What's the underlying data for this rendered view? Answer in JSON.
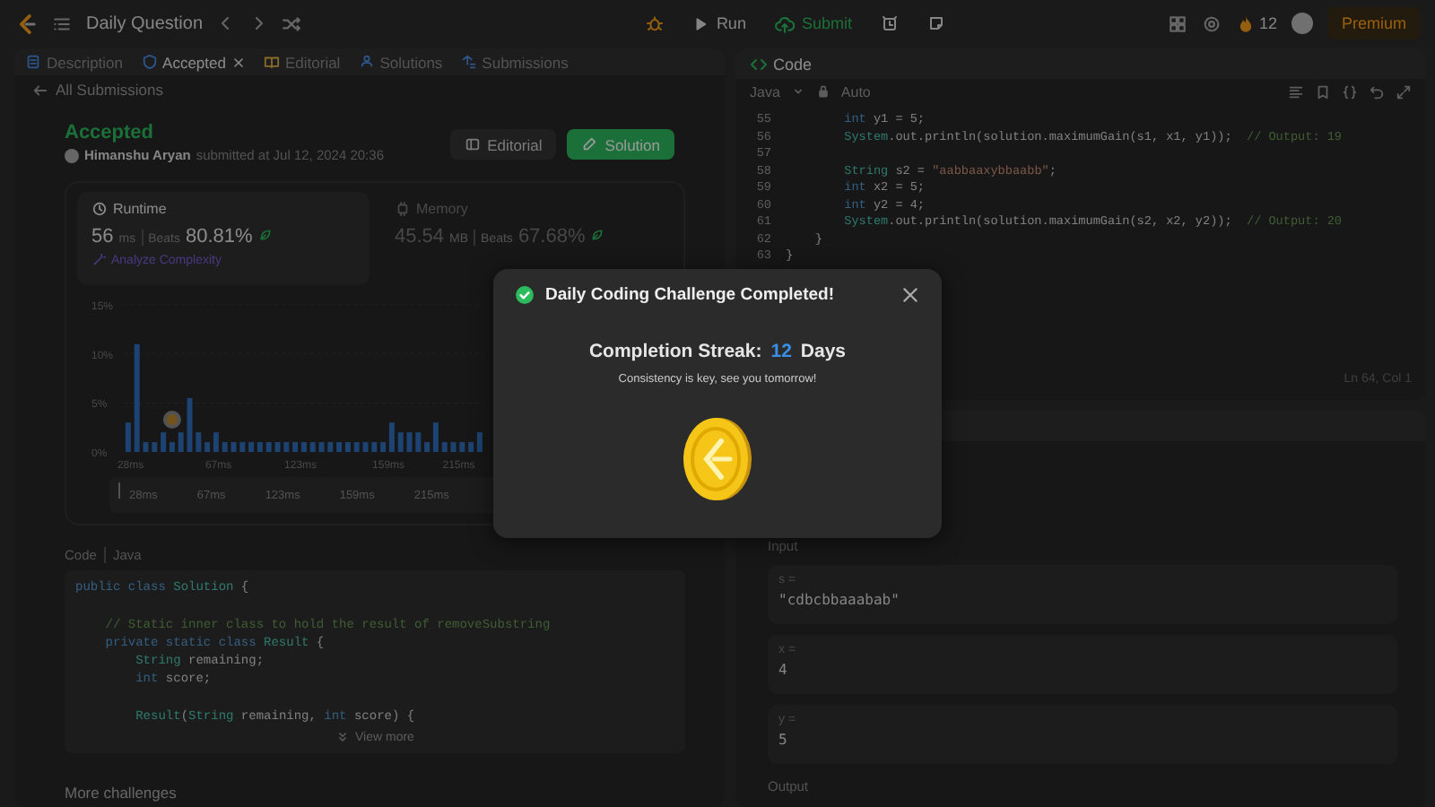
{
  "top_bar": {
    "title": "Daily Question",
    "run": "Run",
    "submit": "Submit",
    "streak": "12",
    "premium": "Premium"
  },
  "left_panel": {
    "tabs": [
      {
        "label": "Description",
        "selected": false,
        "closable": false
      },
      {
        "label": "Accepted",
        "selected": true,
        "closable": true
      },
      {
        "label": "Editorial",
        "selected": false,
        "closable": false
      },
      {
        "label": "Solutions",
        "selected": false,
        "closable": false
      },
      {
        "label": "Submissions",
        "selected": false,
        "closable": false
      }
    ],
    "back": "All Submissions",
    "submission": {
      "status": "Accepted",
      "author": "Himanshu Aryan",
      "submitted": "submitted at Jul 12, 2024 20:36",
      "buttons": [
        {
          "label": "Editorial",
          "kind": "secondary"
        },
        {
          "label": "Solution",
          "kind": "primary"
        }
      ]
    },
    "stats": [
      {
        "label": "Runtime",
        "value": "56",
        "unit": "ms",
        "beats_label": "Beats",
        "beats": "80.81%",
        "link": "Analyze Complexity",
        "selected": true
      },
      {
        "label": "Memory",
        "value": "45.54",
        "unit": "MB",
        "beats_label": "Beats",
        "beats": "67.68%",
        "selected": false
      }
    ],
    "chart_data": {
      "type": "bar",
      "ylim": [
        0,
        15
      ],
      "yticks": [
        {
          "value": 0,
          "label": "0%"
        },
        {
          "value": 5,
          "label": "5%"
        },
        {
          "value": 10,
          "label": "10%"
        },
        {
          "value": 15,
          "label": "15%"
        }
      ],
      "values": [
        3,
        11,
        1,
        1,
        2,
        1,
        2,
        5.5,
        2,
        1,
        2,
        1,
        1,
        1,
        1,
        1,
        1,
        1,
        1,
        1,
        1,
        1,
        1,
        1,
        1,
        1,
        1,
        1,
        1,
        1,
        3,
        2,
        2,
        2,
        1,
        3,
        1,
        1,
        1,
        1,
        2
      ]
    },
    "chart_axis_labels": [
      "28ms",
      "67ms",
      "123ms",
      "159ms",
      "215ms"
    ],
    "range": {
      "labels": [
        "28ms",
        "67ms",
        "123ms",
        "159ms",
        "215ms"
      ]
    },
    "code": {
      "label": "Code",
      "language": "Java",
      "view_more": "View more",
      "lines": [
        {
          "kind": "code",
          "tokens": [
            {
              "kind": "kw",
              "t": "public class"
            },
            {
              "kind": "type",
              "t": " Solution"
            },
            {
              "kind": "plain",
              "t": " {"
            }
          ]
        },
        {
          "kind": "blank"
        },
        {
          "kind": "code",
          "tokens": [
            {
              "kind": "com",
              "t": "    // Static inner class to hold the result of removeSubstring"
            }
          ]
        },
        {
          "kind": "code",
          "tokens": [
            {
              "kind": "kw",
              "t": "    private static class"
            },
            {
              "kind": "type",
              "t": " Result"
            },
            {
              "kind": "plain",
              "t": " {"
            }
          ]
        },
        {
          "kind": "code",
          "tokens": [
            {
              "kind": "type",
              "t": "        String"
            },
            {
              "kind": "plain",
              "t": " remaining;"
            }
          ]
        },
        {
          "kind": "code",
          "tokens": [
            {
              "kind": "kw",
              "t": "        int"
            },
            {
              "kind": "plain",
              "t": " score;"
            }
          ]
        },
        {
          "kind": "blank"
        },
        {
          "kind": "code",
          "tokens": [
            {
              "kind": "type",
              "t": "        Result"
            },
            {
              "kind": "plain",
              "t": "("
            },
            {
              "kind": "type",
              "t": "String"
            },
            {
              "kind": "plain",
              "t": " remaining, "
            },
            {
              "kind": "kw",
              "t": "int"
            },
            {
              "kind": "plain",
              "t": " score) {"
            }
          ]
        }
      ]
    },
    "more": "More challenges"
  },
  "editor": {
    "title": "Code",
    "language": "Java",
    "mode": "Auto",
    "status": "Ln 64, Col 1",
    "lines": [
      {
        "number": "55",
        "tokens": [
          {
            "kind": "kw",
            "t": "        int"
          },
          {
            "kind": "plain",
            "t": " y1 = 5;"
          }
        ]
      },
      {
        "number": "56",
        "tokens": [
          {
            "kind": "type",
            "t": "        System"
          },
          {
            "kind": "plain",
            "t": ".out.println(solution.maximumGain(s1, x1, y1));"
          },
          {
            "kind": "com",
            "t": "  // Output: 19"
          }
        ]
      },
      {
        "number": "57"
      },
      {
        "number": "58",
        "tokens": [
          {
            "kind": "type",
            "t": "        String"
          },
          {
            "kind": "plain",
            "t": " s2 = "
          },
          {
            "kind": "str",
            "t": "\"aabbaaxybbaabb\""
          },
          {
            "kind": "plain",
            "t": ";"
          }
        ]
      },
      {
        "number": "59",
        "tokens": [
          {
            "kind": "kw",
            "t": "        int"
          },
          {
            "kind": "plain",
            "t": " x2 = 5;"
          }
        ]
      },
      {
        "number": "60",
        "tokens": [
          {
            "kind": "kw",
            "t": "        int"
          },
          {
            "kind": "plain",
            "t": " y2 = 4;"
          }
        ]
      },
      {
        "number": "61",
        "tokens": [
          {
            "kind": "type",
            "t": "        System"
          },
          {
            "kind": "plain",
            "t": ".out.println(solution.maximumGain(s2, x2, y2));"
          },
          {
            "kind": "com",
            "t": "  // Output: 20"
          }
        ]
      },
      {
        "number": "62",
        "tokens": [
          {
            "kind": "plain",
            "t": "    }"
          }
        ]
      },
      {
        "number": "63",
        "tokens": [
          {
            "kind": "plain",
            "t": "}"
          }
        ]
      }
    ]
  },
  "testcase": {
    "input_label": "Input",
    "params": [
      {
        "name": "s =",
        "value": "\"cdbcbbaaabab\""
      },
      {
        "name": "x =",
        "value": "4"
      },
      {
        "name": "y =",
        "value": "5"
      }
    ],
    "output_label": "Output"
  },
  "modal": {
    "title": "Daily Coding Challenge Completed!",
    "streak_label": "Completion Streak:",
    "streak": "12",
    "streak_unit": "Days",
    "message": "Consistency is key, see you tomorrow!"
  }
}
